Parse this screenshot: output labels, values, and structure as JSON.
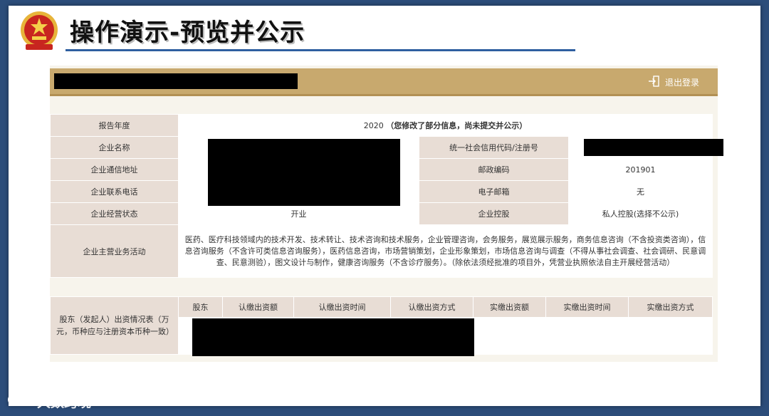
{
  "slide": {
    "title": "操作演示-预览并公示",
    "emblem_icon": "national-emblem-icon"
  },
  "topbar": {
    "logout_label": "退出登录",
    "logout_icon": "exit-door-icon"
  },
  "report": {
    "year_label": "报告年度",
    "year_value": "2020",
    "year_status": "（您修改了部分信息，尚未提交并公示）",
    "company_name_label": "企业名称",
    "credit_code_label": "统一社会信用代码/注册号",
    "address_label": "企业通信地址",
    "postal_label": "邮政编码",
    "postal_value": "201901",
    "phone_label": "企业联系电话",
    "email_label": "电子邮箱",
    "email_value": "无",
    "status_label": "企业经营状态",
    "status_value": "开业",
    "holding_label": "企业控股",
    "holding_value": "私人控股(选择不公示)",
    "business_label": "企业主营业务活动",
    "business_value": "医药、医疗科技领域内的技术开发、技术转让、技术咨询和技术服务，企业管理咨询，会务服务，展览展示服务，商务信息咨询（不含投资类咨询），信息咨询服务（不含许可类信息咨询服务），医药信息咨询，市场营销策划，企业形象策划，市场信息咨询与调查（不得从事社会调查、社会调研、民意调查、民意测验），图文设计与制作，健康咨询服务（不含诊疗服务）。（除依法须经批准的项目外，凭营业执照依法自主开展经营活动）"
  },
  "shareholders": {
    "section_label": "股东（发起人）出资情况表（万元，币种应与注册资本币种一致）",
    "columns": [
      "股东",
      "认缴出资额",
      "认缴出资时间",
      "认缴出资方式",
      "实缴出资额",
      "实缴出资时间",
      "实缴出资方式"
    ]
  },
  "watermark": {
    "text": "大数跨境"
  },
  "colors": {
    "background": "#2c4d7a",
    "topbar": "#c8a96e",
    "label_cell": "#e8ddd5",
    "title_rule": "#2f5fa0"
  }
}
